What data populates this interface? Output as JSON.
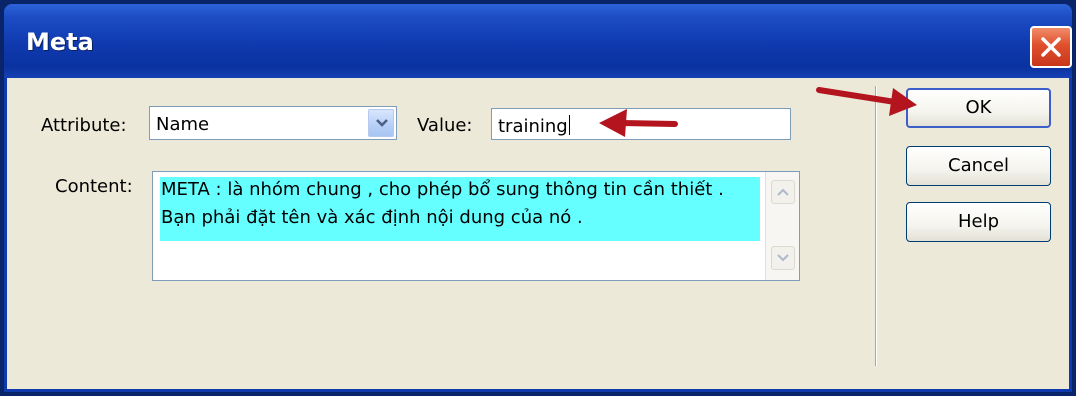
{
  "window": {
    "title": "Meta"
  },
  "form": {
    "attribute_label": "Attribute:",
    "attribute_value": "Name",
    "value_label": "Value:",
    "value_text": "training",
    "content_label": "Content:",
    "content_lines": [
      "META : là nhóm chung , cho phép bổ sung thông tin cần thiết .",
      " Bạn phải đặt tên và xác định nội dung của nó ."
    ]
  },
  "buttons": {
    "ok": "OK",
    "cancel": "Cancel",
    "help": "Help"
  },
  "colors": {
    "titlebar": "#0f3aae",
    "dialog_bg": "#ece9d8",
    "content_highlight": "#66ffff",
    "annotation_arrow": "#b3141e",
    "close_button": "#e0502c"
  },
  "icons": {
    "close": "close-x-icon",
    "dropdown": "chevron-down-icon",
    "scroll_up": "scroll-up-arrow-icon",
    "scroll_down": "scroll-down-arrow-icon",
    "annotation": "red-arrow-annotation"
  }
}
